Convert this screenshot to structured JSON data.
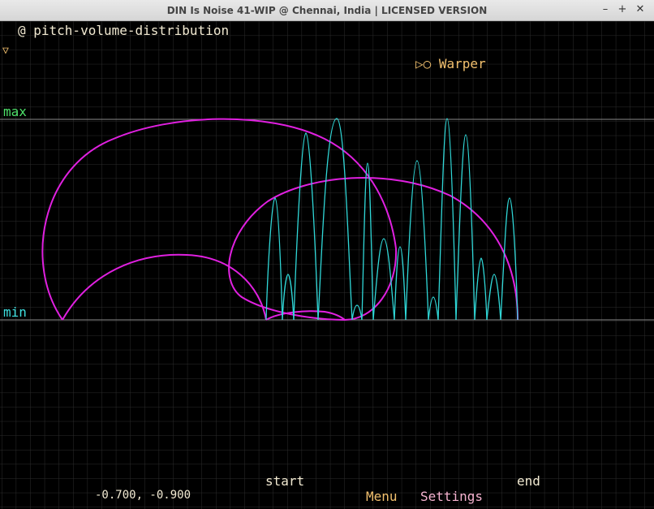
{
  "window": {
    "title": "DIN Is Noise 41-WIP @ Chennai, India | LICENSED VERSION",
    "minimize_glyph": "–",
    "maximize_glyph": "+",
    "close_glyph": "✕"
  },
  "editor": {
    "name": "@ pitch-volume-distribution",
    "collapse_glyph": "▽",
    "warper_label": "▷○ Warper",
    "max_label": "max",
    "min_label": "min",
    "start_label": "start",
    "end_label": "end",
    "cursor_readout": "-0.700, -0.900",
    "menu_label": "Menu",
    "settings_label": "Settings"
  },
  "colors": {
    "background": "#000000",
    "grid": "#2c2c2c",
    "guide_lines": "#8a8a8a",
    "curve_magenta": "#e020e0",
    "curve_cyan": "#30d8d8",
    "label_yellow": "#f2ead2",
    "label_orange": "#f2c06e",
    "label_green": "#4fe06a",
    "label_cyan": "#3fe0e0",
    "label_pink": "#f6b3d0"
  }
}
